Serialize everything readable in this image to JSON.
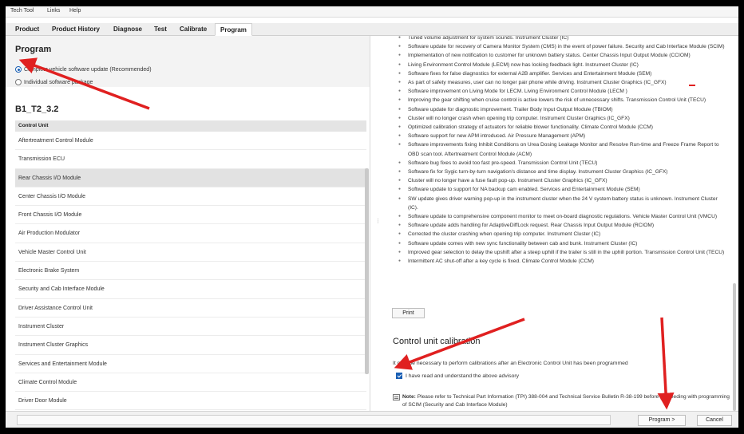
{
  "menu": [
    "Tech Tool",
    "Links",
    "Help"
  ],
  "tabs": [
    "Product",
    "Product History",
    "Diagnose",
    "Test",
    "Calibrate",
    "Program"
  ],
  "active_tab": "Program",
  "program": {
    "title": "Program",
    "options": [
      {
        "label": "Complete vehicle software update (Recommended)",
        "checked": true
      },
      {
        "label": "Individual software package",
        "checked": false
      }
    ]
  },
  "package": {
    "title": "B1_T2_3.2",
    "column_header": "Control Unit",
    "rows": [
      "Aftertreatment Control Module",
      "Transmission ECU",
      "Rear Chassis I/O Module",
      "Center Chassis I/O Module",
      "Front Chassis I/O Module",
      "Air Production Modulator",
      "Vehicle Master Control Unit",
      "Electronic Brake System",
      "Security and Cab Interface Module",
      "Driver Assistance Control Unit",
      "Instrument Cluster",
      "Instrument Cluster Graphics",
      "Services and Entertainment Module",
      "Climate Control Module",
      "Driver Door Module"
    ],
    "selected_row": "Rear Chassis I/O Module"
  },
  "release_notes": [
    "Tuned volume adjustment for system sounds. Instrument Cluster (IC)",
    "Software update for recovery of Camera Monitor System (CMS) in the event of power failure. Security and Cab Interface Module (SCIM)",
    "Implementation of new notification to customer for unknown battery status. Center Chassis Input Output Module (CCIOM)",
    "Living Environment Control Module (LECM) now has locking feedback light. Instrument Cluster (IC)",
    "Software fixes for false diagnostics for external A2B amplifier. Services and Entertainment Module (SEM)",
    "As part of safety measures, user can no longer pair phone while driving. Instrument Cluster Graphics (IC_GFX)",
    "Software improvement on Living Mode for LECM. Living Environment Control Module (LECM )",
    "Improving the gear shifting when cruise control is active lowers the risk of unnecessary shifts. Transmission Control Unit (TECU)",
    "Software update for diagnostic improvement. Trailer Body Input Output Module (TBIOM)",
    "Cluster will no longer crash when opening trip computer. Instrument Cluster Graphics (IC_GFX)",
    "Optimized calibration strategy of actuators for reliable blower functionality. Climate Control Module (CCM)",
    "Software support for new APM introduced. Air Pressure Management (APM)",
    "Software improvements fixing Inhibit Conditions on Urea Dosing Leakage Monitor and Resolve Run-time and Freeze Frame Report to OBD scan tool. Aftertreatment Control Module (ACM)",
    "Software bug fixes to avoid too fast pre-speed. Transmission Control Unit (TECU)",
    "Software fix for Sygic turn-by-turn navigation's distance and time display. Instrument Cluster Graphics (IC_GFX)",
    "Cluster will no longer have a fuse fault pop-up. Instrument Cluster Graphics (IC_GFX)",
    "Software update to support for NA backup cam enabled. Services and Entertainment Module (SEM)",
    "SW update gives driver warning pop-up in the instrument cluster when the 24 V system battery status is unknown. Instrument Cluster (IC).",
    "Software update to comprehensive component monitor to meet on-board diagnostic regulations. Vehicle Master Control Unit (VMCU)",
    "Software update adds handling for AdaptiveDiffLock request. Rear Chassis Input Output Module (RCIOM)",
    "Corrected the cluster crashing when opening trip computer. Instrument Cluster (IC)",
    "Software update comes with new sync functionality between cab and bunk. Instrument Cluster (IC)",
    "Improved gear selection to delay the upshift after a steep uphill if the trailer is still in the uphill portion. Transmission Control Unit (TECU)",
    "Intermittent AC shut-off after a key cycle is fixed. Climate Control Module (CCM)"
  ],
  "print_label": "Print",
  "calibration": {
    "heading": "Control unit calibration",
    "text": "It may be necessary to perform calibrations after an Electronic Control Unit has been programmed",
    "advisory_label": "I have read and understand the above advisory",
    "advisory_checked": true,
    "note_label": "Note:",
    "note_text": "Please refer to Technical Part Information (TPI) 388-004 and Technical Service Bulletin R-38-199 before proceeding with programming of SCIM (Security and Cab Interface Module)"
  },
  "footer": {
    "program_label": "Program >",
    "cancel_label": "Cancel"
  },
  "colors": {
    "accent": "#1a5fb4",
    "annotation_red": "#e02020"
  }
}
